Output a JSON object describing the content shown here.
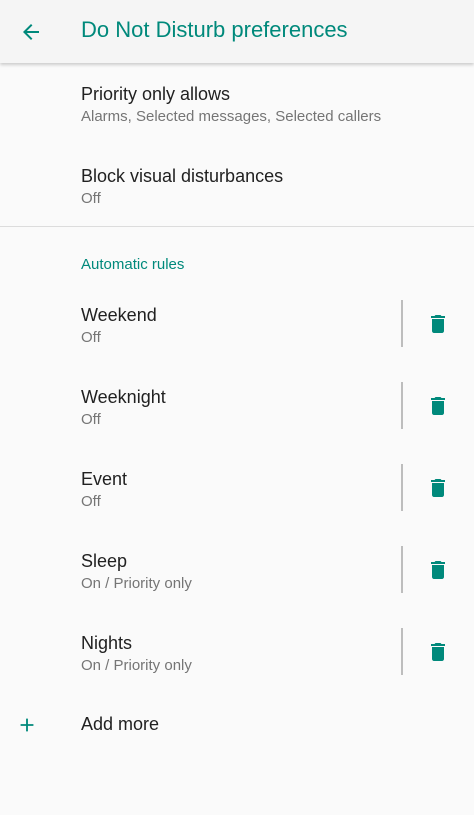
{
  "header": {
    "title": "Do Not Disturb preferences",
    "back_icon": "arrow-left-icon"
  },
  "preferences": [
    {
      "title": "Priority only allows",
      "summary": "Alarms, Selected messages, Selected callers"
    },
    {
      "title": "Block visual disturbances",
      "summary": "Off"
    }
  ],
  "automatic_rules": {
    "header": "Automatic rules",
    "rules": [
      {
        "name": "Weekend",
        "status": "Off"
      },
      {
        "name": "Weeknight",
        "status": "Off"
      },
      {
        "name": "Event",
        "status": "Off"
      },
      {
        "name": "Sleep",
        "status": "On / Priority only"
      },
      {
        "name": "Nights",
        "status": "On / Priority only"
      }
    ],
    "delete_icon": "trash-icon",
    "add_more": {
      "label": "Add more",
      "icon": "plus-icon"
    }
  },
  "colors": {
    "accent": "#00897b",
    "primary_text": "#212121",
    "secondary_text": "#757575",
    "background": "#fafafa",
    "appbar": "#f5f5f5"
  }
}
